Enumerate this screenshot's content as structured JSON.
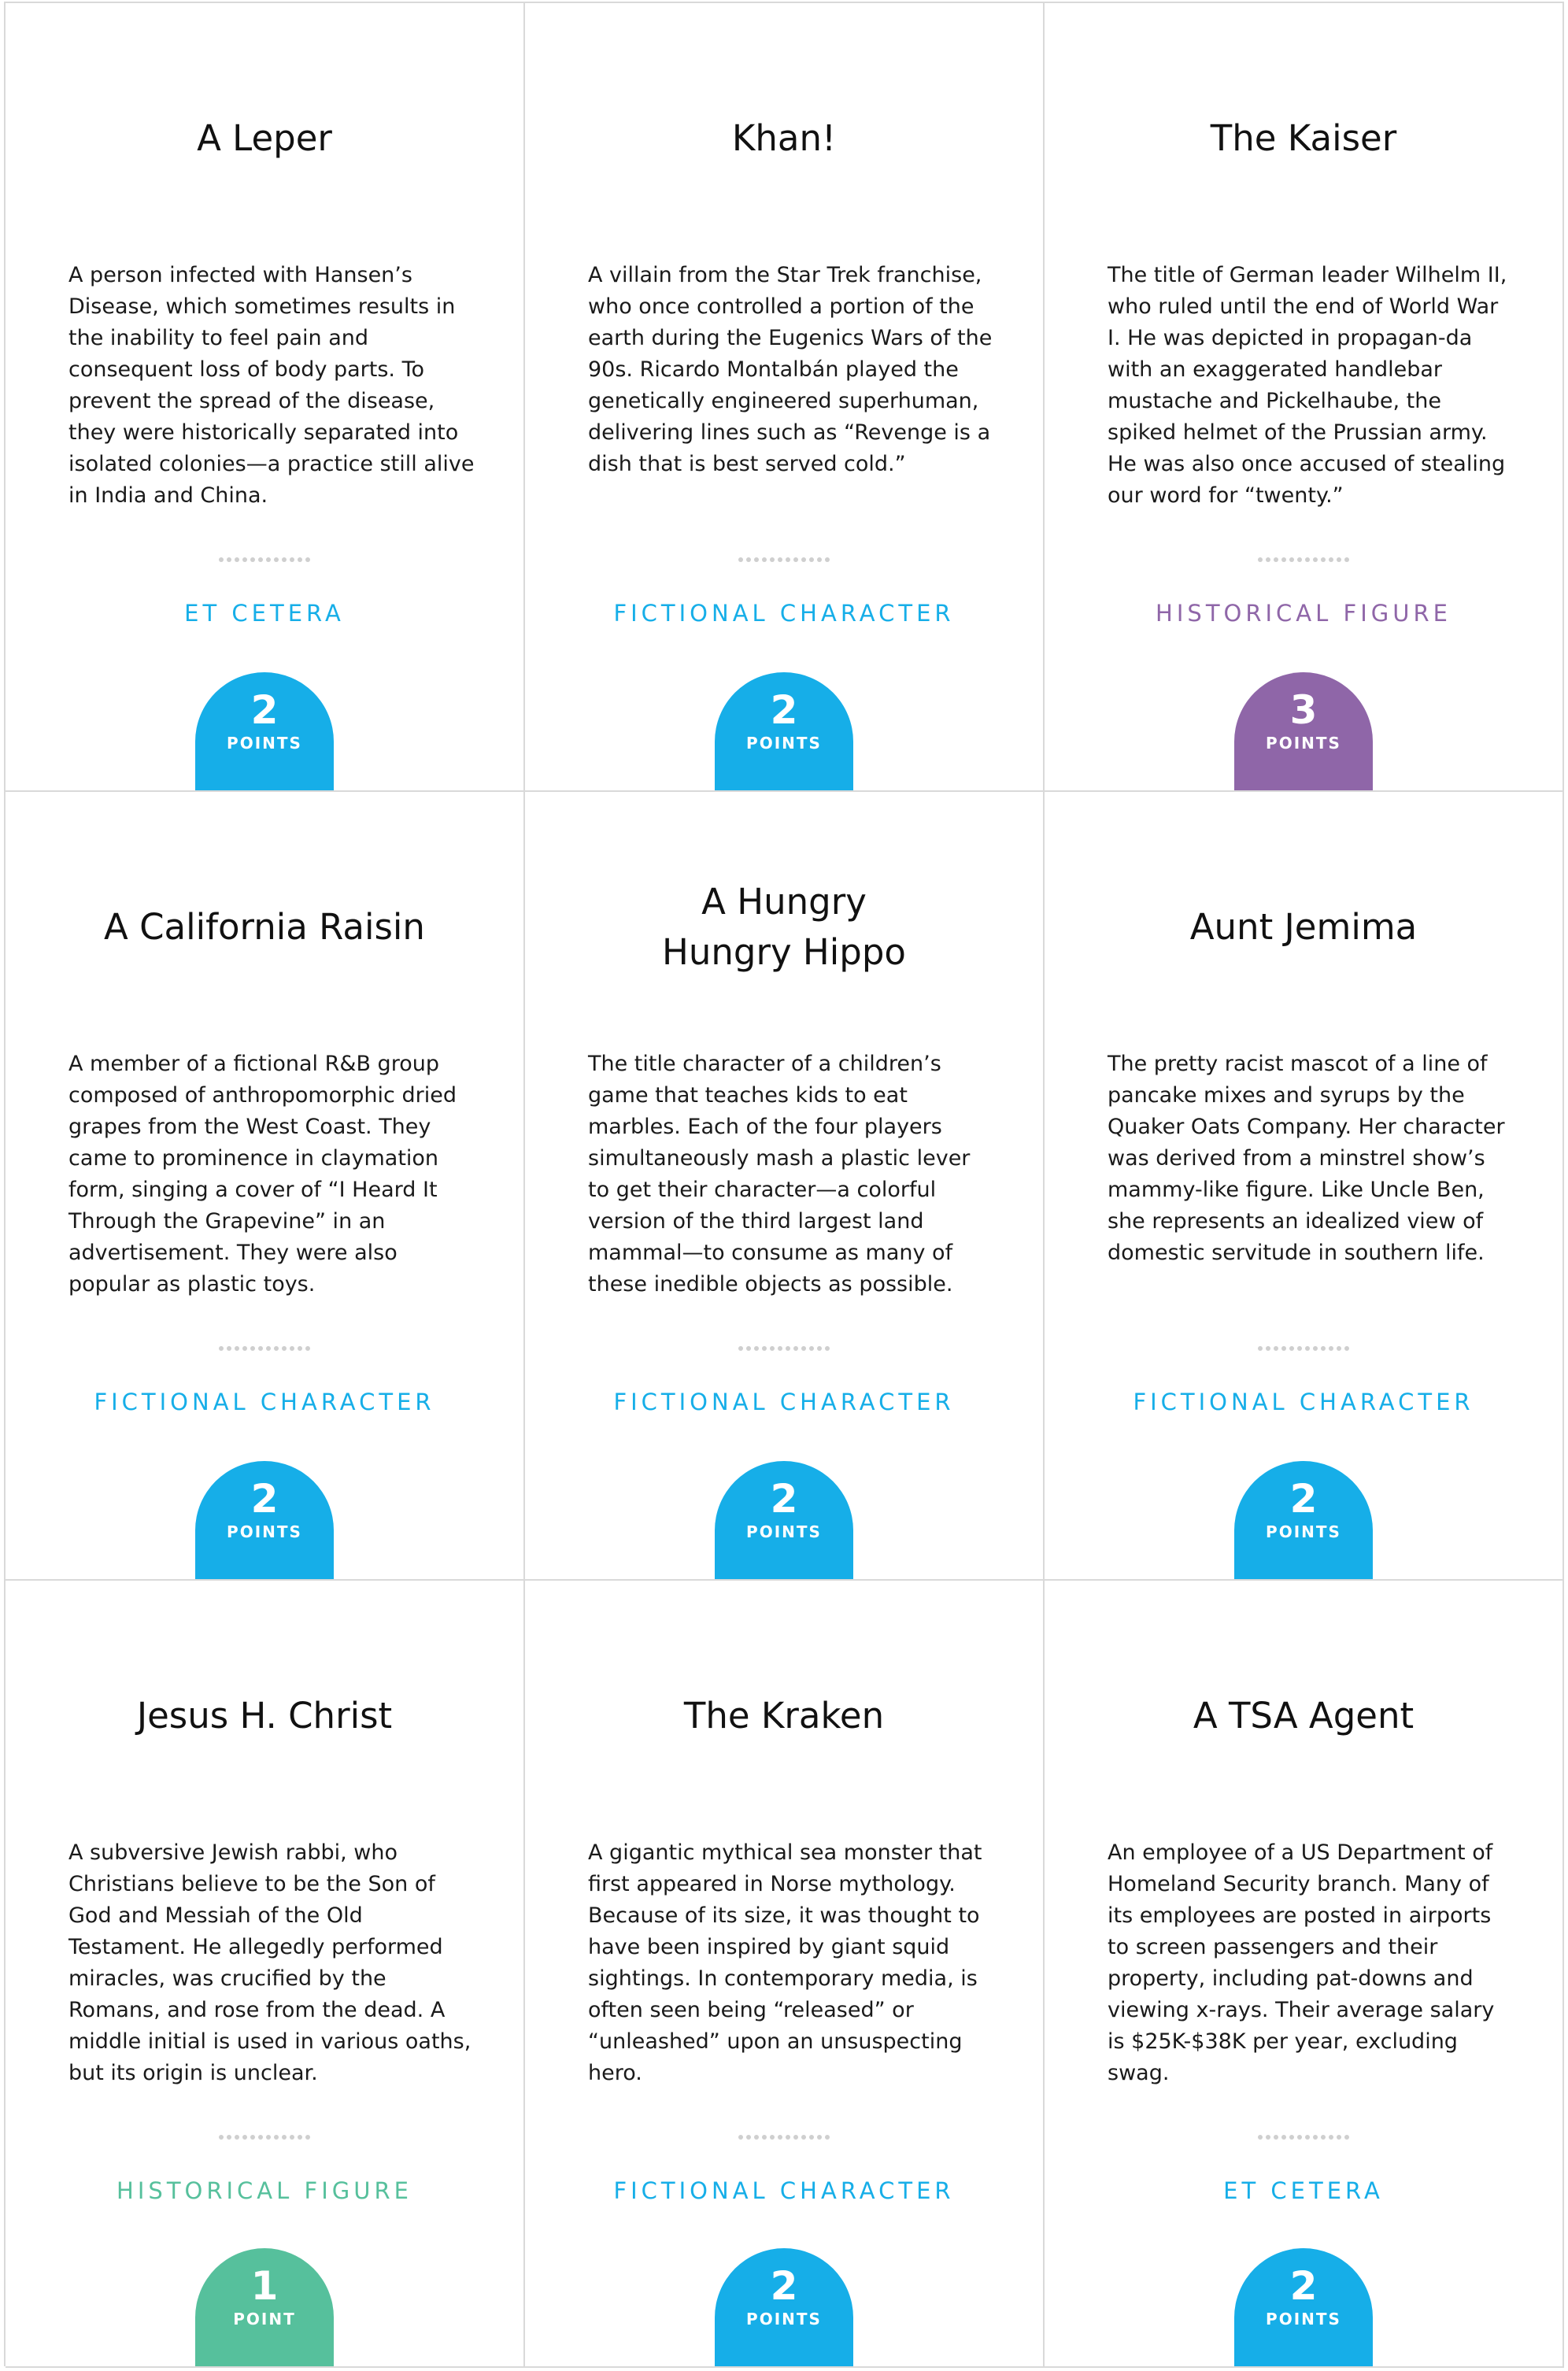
{
  "colors": {
    "et_cetera": "#16aee8",
    "fictional_character": "#16aee8",
    "historical_figure_purple": "#8f66a8",
    "historical_figure_green": "#56c09c",
    "border": "#d9d9d9"
  },
  "cards": [
    {
      "title": "A Leper",
      "description": "A person infected with Hansen’s Disease, which sometimes results in the inability to feel pain and consequent loss of body parts. To prevent the spread of the disease, they were historically separated into isolated colonies—a practice still alive in India and China.",
      "category": "ET CETERA",
      "points": "2",
      "points_label": "POINTS",
      "color": "#16aee8"
    },
    {
      "title": "Khan!",
      "description": "A villain from the Star Trek franchise, who once controlled a portion of the earth during the Eugenics Wars of the 90s. Ricardo Montalbán played the genetically engineered superhuman, delivering lines such as “Revenge is a dish that is best served cold.”",
      "category": "FICTIONAL CHARACTER",
      "points": "2",
      "points_label": "POINTS",
      "color": "#16aee8"
    },
    {
      "title": "The Kaiser",
      "description": "The title of German leader Wilhelm II, who ruled until the end of World War I. He was depicted in propagan-da with an exaggerated handlebar mustache and Pickelhaube, the spiked helmet of the Prussian army. He was also once accused of stealing our word for “twenty.”",
      "category": "HISTORICAL FIGURE",
      "points": "3",
      "points_label": "POINTS",
      "color": "#8f66a8"
    },
    {
      "title": "A California Raisin",
      "description": "A member of a fictional R&B group composed of anthropomorphic dried grapes from the West Coast. They came to prominence in claymation form, singing a cover of “I Heard It Through the Grapevine” in an advertisement. They were also popular as plastic toys.",
      "category": "FICTIONAL CHARACTER",
      "points": "2",
      "points_label": "POINTS",
      "color": "#16aee8"
    },
    {
      "title": "A Hungry\nHungry Hippo",
      "description": "The title character of a children’s game that teaches kids to eat marbles. Each of the four players simultaneously mash a plastic lever to get their character—a colorful version of the third largest land mammal—to consume as many of these inedible objects as possible.",
      "category": "FICTIONAL CHARACTER",
      "points": "2",
      "points_label": "POINTS",
      "color": "#16aee8"
    },
    {
      "title": "Aunt Jemima",
      "description": "The pretty racist mascot of a line of pancake mixes and syrups by the Quaker Oats Company. Her character was derived from a minstrel show’s mammy-like figure. Like Uncle Ben, she represents an idealized view of domestic servitude in southern life.",
      "category": "FICTIONAL CHARACTER",
      "points": "2",
      "points_label": "POINTS",
      "color": "#16aee8"
    },
    {
      "title": "Jesus H. Christ",
      "description": "A subversive Jewish rabbi, who Christians believe to be the Son of God and Messiah of the Old Testament. He allegedly performed miracles, was crucified by the Romans, and rose from the dead. A middle initial is used in various oaths, but its origin is unclear.",
      "category": "HISTORICAL FIGURE",
      "points": "1",
      "points_label": "POINT",
      "color": "#56c09c"
    },
    {
      "title": "The Kraken",
      "description": "A gigantic mythical sea monster that first appeared in Norse mythology. Because of its size, it was thought to have been inspired by giant squid sightings. In contemporary media, is often seen being “released” or “unleashed” upon an unsuspecting hero.",
      "category": "FICTIONAL CHARACTER",
      "points": "2",
      "points_label": "POINTS",
      "color": "#16aee8"
    },
    {
      "title": "A TSA Agent",
      "description": "An employee of a US Department of Homeland Security branch. Many of its employees are posted in airports to screen passengers and their property, including pat-downs and viewing x-rays. Their average salary is $25K-$38K per year, excluding swag.",
      "category": "ET CETERA",
      "points": "2",
      "points_label": "POINTS",
      "color": "#16aee8"
    }
  ]
}
